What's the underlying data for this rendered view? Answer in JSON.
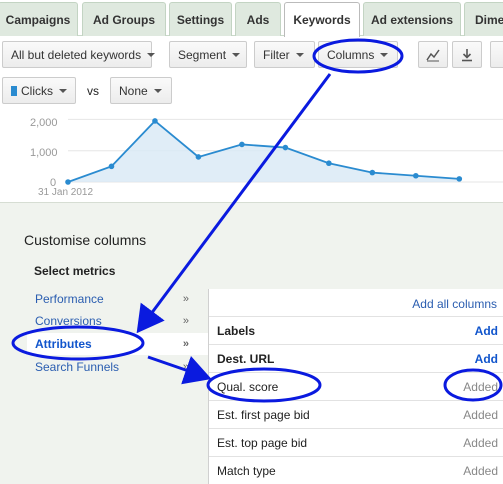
{
  "tabs": [
    "Campaigns",
    "Ad Groups",
    "Settings",
    "Ads",
    "Keywords",
    "Ad extensions",
    "Dime"
  ],
  "active_tab": "Keywords",
  "toolbar": {
    "filter_view": "All but deleted keywords",
    "segment": "Segment",
    "filter": "Filter",
    "columns": "Columns"
  },
  "metrics": {
    "primary": "Clicks",
    "vs": "vs",
    "secondary": "None",
    "primary_color": "#2a8bd0"
  },
  "chart_data": {
    "type": "area",
    "x": [
      "31 Jan 2012",
      "",
      "",
      "",
      "",
      "",
      "",
      "",
      "",
      ""
    ],
    "series": [
      {
        "name": "Clicks",
        "values": [
          0,
          500,
          1950,
          800,
          1200,
          1100,
          600,
          300,
          200,
          100
        ]
      }
    ],
    "yticks": [
      "2,000",
      "1,000",
      "0"
    ],
    "ylim": [
      0,
      2300
    ],
    "xlabel": "31 Jan 2012"
  },
  "panel": {
    "title": "Customise columns",
    "subtitle": "Select metrics",
    "categories": [
      {
        "label": "Performance",
        "selected": false
      },
      {
        "label": "Conversions",
        "selected": false
      },
      {
        "label": "Attributes",
        "selected": true
      },
      {
        "label": "Search Funnels",
        "selected": false
      }
    ],
    "add_all": "Add all columns",
    "columns": [
      {
        "label": "Labels",
        "action": "Add",
        "bold": true
      },
      {
        "label": "Dest. URL",
        "action": "Add",
        "bold": true
      },
      {
        "label": "Qual. score",
        "action": "Added",
        "bold": false
      },
      {
        "label": "Est. first page bid",
        "action": "Added",
        "bold": false
      },
      {
        "label": "Est. top page bid",
        "action": "Added",
        "bold": false
      },
      {
        "label": "Match type",
        "action": "Added",
        "bold": false
      }
    ]
  },
  "annotation_color": "#0a1adf"
}
